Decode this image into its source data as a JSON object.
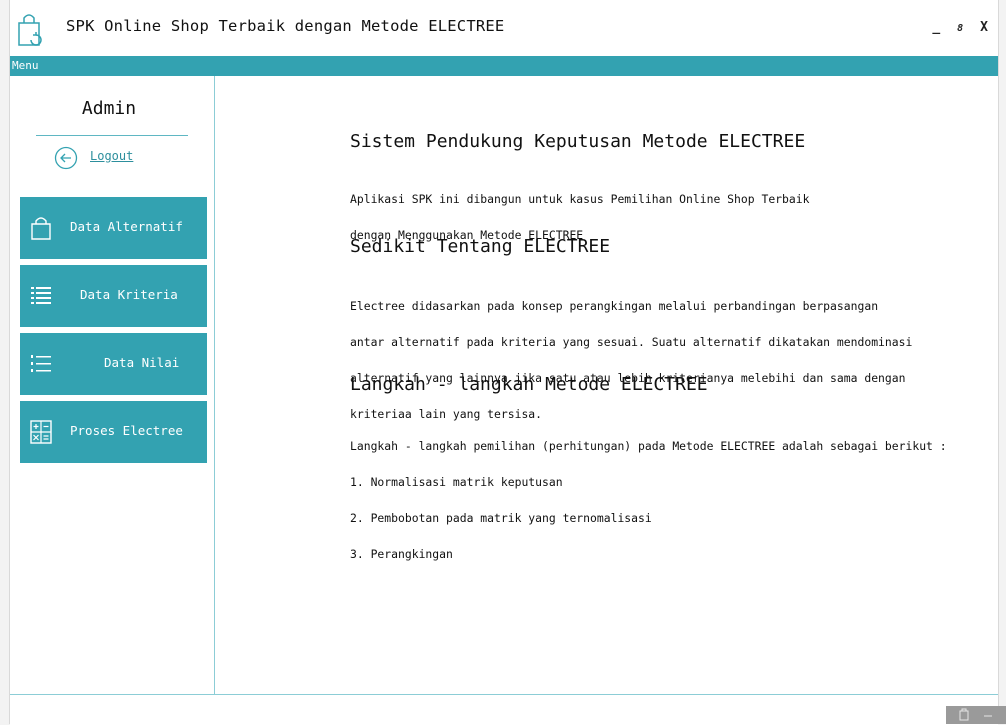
{
  "window": {
    "title": "SPK Online Shop Terbaik dengan Metode ELECTREE",
    "controls": {
      "minimize": "_",
      "restore": "8",
      "close": "X"
    }
  },
  "menubar": {
    "label": "Menu"
  },
  "sidebar": {
    "admin_name": "Admin",
    "logout_label": "Logout",
    "items": [
      {
        "label": "Data Alternatif",
        "icon": "shopping-bag-icon"
      },
      {
        "label": "Data Kriteria",
        "icon": "list-icon"
      },
      {
        "label": "Data Nilai",
        "icon": "numbered-list-icon"
      },
      {
        "label": "Proses Electree",
        "icon": "calculator-icon"
      }
    ]
  },
  "content": {
    "section1": {
      "heading": "Sistem Pendukung Keputusan Metode ELECTREE",
      "lines": [
        "Aplikasi SPK ini dibangun untuk kasus Pemilihan Online Shop Terbaik",
        "dengan Menggunakan Metode ELECTREE"
      ]
    },
    "section2": {
      "heading": "Sedikit Tentang ELECTREE",
      "lines": [
        "Electree didasarkan pada konsep perangkingan melalui perbandingan berpasangan",
        "antar alternatif pada kriteria yang sesuai. Suatu alternatif dikatakan mendominasi",
        "alternatif yang lainnya jika satu atau lebih kriterianya melebihi dan sama dengan",
        "kriteriaa lain yang tersisa."
      ]
    },
    "section3": {
      "heading": "Langkah - langkah Metode ELECTREE",
      "lines": [
        "Langkah - langkah pemilihan (perhitungan) pada Metode ELECTREE adalah sebagai berikut :",
        "1. Normalisasi matrik keputusan",
        "2. Pembobotan pada matrik yang ternomalisasi",
        "3. Perangkingan"
      ]
    }
  },
  "colors": {
    "accent": "#33a2b1",
    "accent_light": "#8ccdd6"
  }
}
